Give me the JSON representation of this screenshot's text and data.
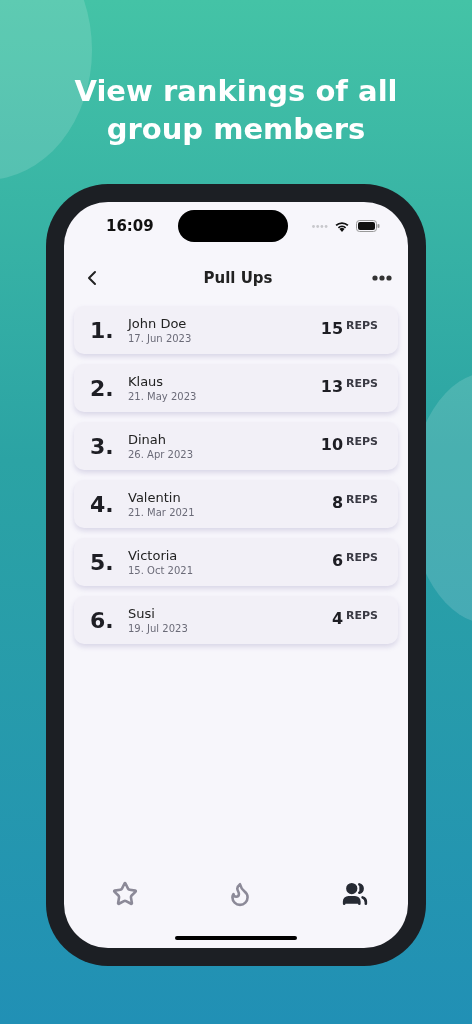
{
  "headline": "View rankings of all group members",
  "status_bar": {
    "time": "16:09"
  },
  "nav_bar": {
    "title": "Pull Ups"
  },
  "rankings": [
    {
      "rank": "1.",
      "name": "John Doe",
      "date": "17. Jun 2023",
      "reps": "15",
      "unit": "REPS"
    },
    {
      "rank": "2.",
      "name": "Klaus",
      "date": "21. May 2023",
      "reps": "13",
      "unit": "REPS"
    },
    {
      "rank": "3.",
      "name": "Dinah",
      "date": "26. Apr 2023",
      "reps": "10",
      "unit": "REPS"
    },
    {
      "rank": "4.",
      "name": "Valentin",
      "date": "21. Mar 2021",
      "reps": "8",
      "unit": "REPS"
    },
    {
      "rank": "5.",
      "name": "Victoria",
      "date": "15. Oct 2021",
      "reps": "6",
      "unit": "REPS"
    },
    {
      "rank": "6.",
      "name": "Susi",
      "date": "19. Jul 2023",
      "reps": "4",
      "unit": "REPS"
    }
  ],
  "tab_bar": [
    {
      "kind": "star",
      "selected": false
    },
    {
      "kind": "flame",
      "selected": false
    },
    {
      "kind": "group",
      "selected": true
    }
  ]
}
